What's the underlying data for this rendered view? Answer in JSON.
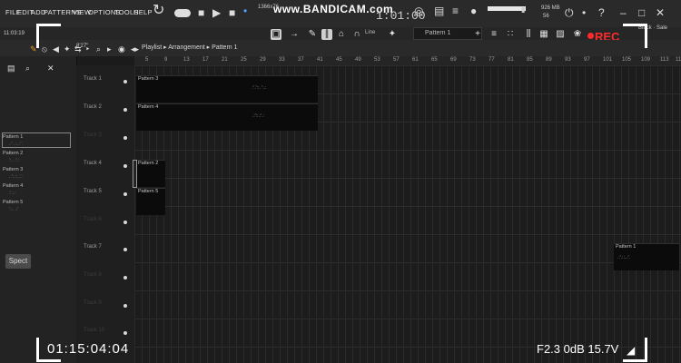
{
  "menus": [
    "FILE",
    "EDIT",
    "ADD",
    "PATTERNS",
    "VIEW",
    "OPTIONS",
    "TOOLS",
    "HELP"
  ],
  "watermark": "www.BANDICAM.com",
  "song_position": "1:01:00",
  "time_counter": "11:03:19",
  "memory": "926 MB",
  "cpu_value": "56",
  "hint_text": "1366x76",
  "browser_toolbar_field": "8'27\"",
  "playlist_breadcrumb": [
    "Playlist",
    "Arrangement",
    "Pattern 1"
  ],
  "pattern_selector": "Pattern 1",
  "snap_mode": "Line",
  "browser_patterns": [
    "Pattern 1",
    "Pattern 2",
    "Pattern 3",
    "Pattern 4",
    "Pattern 5"
  ],
  "spect_label": "Spect",
  "ruler_numbers": [
    "5",
    "9",
    "13",
    "17",
    "21",
    "25",
    "29",
    "33",
    "37",
    "41",
    "45",
    "49",
    "53",
    "57",
    "61",
    "65",
    "69",
    "73",
    "77",
    "81",
    "85",
    "89",
    "93",
    "97",
    "101",
    "105",
    "109",
    "113",
    "117"
  ],
  "tracks": [
    "Track 1",
    "Track 2",
    "Track 3",
    "Track 4",
    "Track 5",
    "Track 6",
    "Track 7",
    "Track 8",
    "Track 9",
    "Track 10"
  ],
  "clips": [
    {
      "track": 1,
      "label": "Pattern 3"
    },
    {
      "track": 2,
      "label": "Pattern 4"
    },
    {
      "track": 4,
      "label": "Pattern 2"
    },
    {
      "track": 5,
      "label": "Pattern 5"
    },
    {
      "track": 7,
      "label": "Pattern 1"
    }
  ],
  "record_label": "REC",
  "record_time": "01:15:04:04",
  "recorder_status": "F2.3  0dB 15.7V",
  "top_right_hint": "Black · Sale",
  "colors": {
    "record": "#ff2a2a",
    "frame": "#ffffff",
    "clip": "#0b0b0b"
  }
}
